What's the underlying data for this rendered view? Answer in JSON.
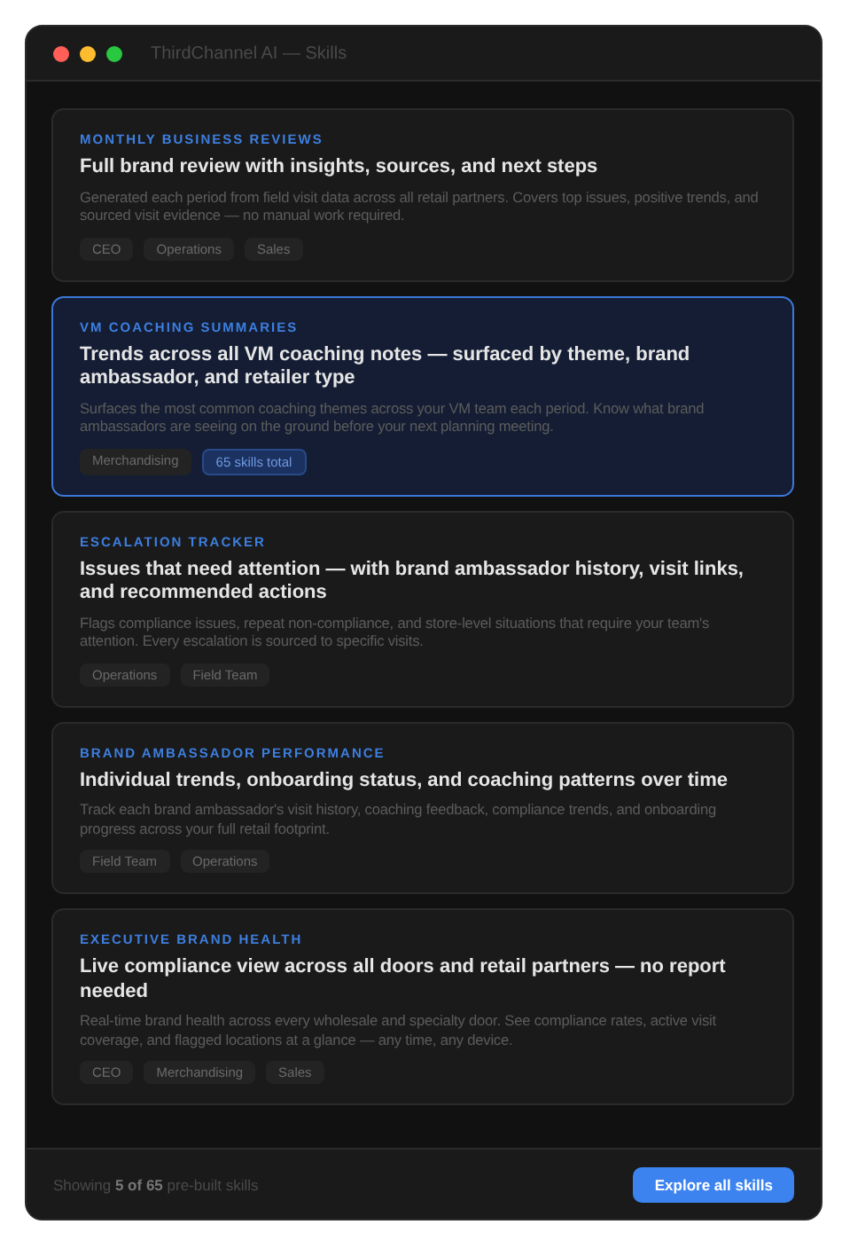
{
  "window": {
    "title": "ThirdChannel AI — Skills"
  },
  "cards": [
    {
      "category": "MONTHLY BUSINESS REVIEWS",
      "title": "Full brand review with insights, sources, and next steps",
      "description": "Generated each period from field visit data across all retail partners. Covers top issues, positive trends, and sourced visit evidence — no manual work required.",
      "selected": false,
      "tags": [
        {
          "label": "CEO",
          "kind": "tag"
        },
        {
          "label": "Operations",
          "kind": "tag"
        },
        {
          "label": "Sales",
          "kind": "tag"
        }
      ]
    },
    {
      "category": "VM COACHING SUMMARIES",
      "title": "Trends across all VM coaching notes — surfaced by theme, brand ambassador, and retailer type",
      "description": "Surfaces the most common coaching themes across your VM team each period. Know what brand ambassadors are seeing on the ground before your next planning meeting.",
      "selected": true,
      "tags": [
        {
          "label": "Merchandising",
          "kind": "tag"
        },
        {
          "label": "65 skills total",
          "kind": "count"
        }
      ]
    },
    {
      "category": "ESCALATION TRACKER",
      "title": "Issues that need attention — with brand ambassador history, visit links, and recommended actions",
      "description": "Flags compliance issues, repeat non-compliance, and store-level situations that require your team's attention. Every escalation is sourced to specific visits.",
      "selected": false,
      "tags": [
        {
          "label": "Operations",
          "kind": "tag"
        },
        {
          "label": "Field Team",
          "kind": "tag"
        }
      ]
    },
    {
      "category": "BRAND AMBASSADOR PERFORMANCE",
      "title": "Individual trends, onboarding status, and coaching patterns over time",
      "description": "Track each brand ambassador's visit history, coaching feedback, compliance trends, and onboarding progress across your full retail footprint.",
      "selected": false,
      "tags": [
        {
          "label": "Field Team",
          "kind": "tag"
        },
        {
          "label": "Operations",
          "kind": "tag"
        }
      ]
    },
    {
      "category": "EXECUTIVE BRAND HEALTH",
      "title": "Live compliance view across all doors and retail partners — no report needed",
      "description": "Real-time brand health across every wholesale and specialty door. See compliance rates, active visit coverage, and flagged locations at a glance — any time, any device.",
      "selected": false,
      "tags": [
        {
          "label": "CEO",
          "kind": "tag"
        },
        {
          "label": "Merchandising",
          "kind": "tag"
        },
        {
          "label": "Sales",
          "kind": "tag"
        }
      ]
    }
  ],
  "footer": {
    "summary": "Showing **5 of 65** pre-built skills",
    "button": "Explore all skills"
  }
}
